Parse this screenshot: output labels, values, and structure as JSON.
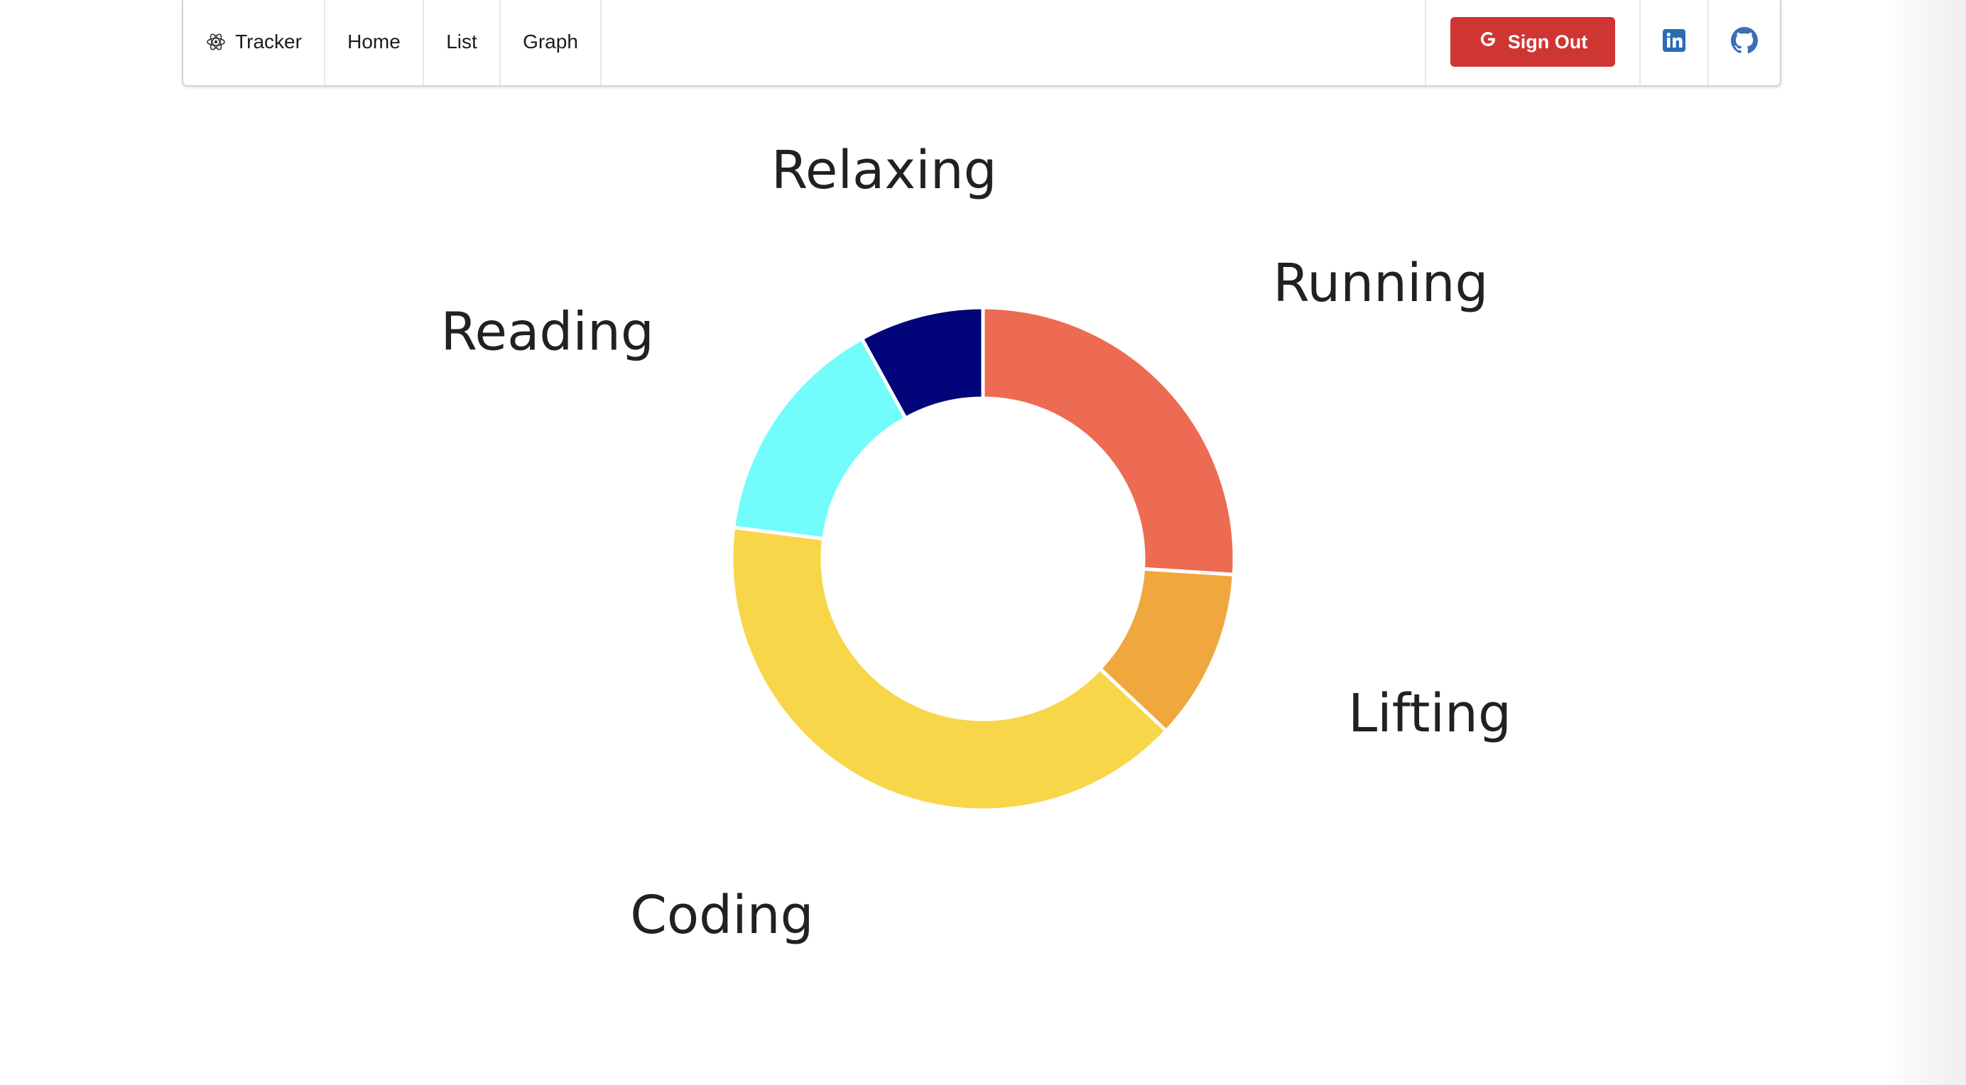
{
  "navbar": {
    "brand": "Tracker",
    "brand_icon": "atom-icon",
    "home": "Home",
    "list": "List",
    "graph": "Graph",
    "sign_out": "Sign Out",
    "sign_out_icon": "google-icon",
    "linkedin_icon": "linkedin-icon",
    "github_icon": "github-icon"
  },
  "colors": {
    "sign_out_bg": "#cf3533",
    "linkedin": "#2b6cb0",
    "running": "#ec6b52",
    "lifting": "#f0a73d",
    "coding": "#f7d64a",
    "reading": "#72fcfc",
    "relaxing": "#020579"
  },
  "chart_data": {
    "type": "pie",
    "donut": true,
    "categories": [
      "Running",
      "Lifting",
      "Coding",
      "Reading",
      "Relaxing"
    ],
    "values": [
      26,
      11,
      40,
      15,
      8
    ],
    "colors": [
      "#ec6b52",
      "#f0a73d",
      "#f7d64a",
      "#72fcfc",
      "#020579"
    ]
  }
}
